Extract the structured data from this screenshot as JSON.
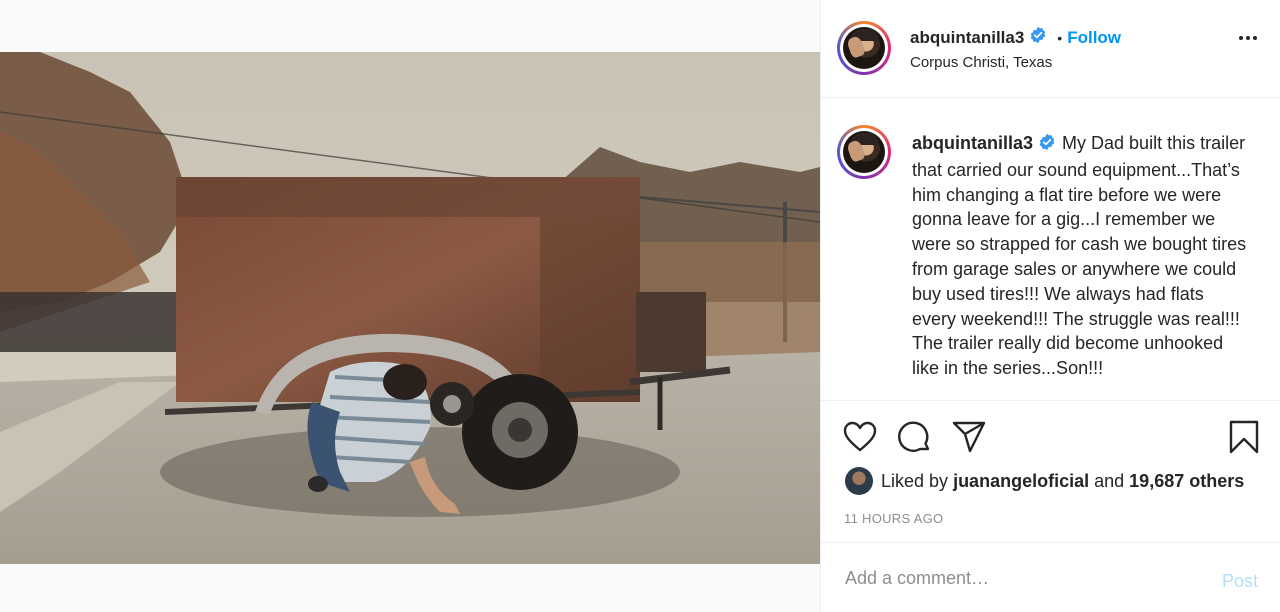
{
  "post": {
    "username": "abquintanilla3",
    "location": "Corpus Christi, Texas",
    "follow_label": "Follow",
    "separator": "•",
    "caption": "My Dad built this trailer that carried our sound equipment...That’s him changing a flat tire before we were gonna leave for a gig...I remember we were so strapped for cash we bought tires from garage sales or anywhere we could buy used tires!!! We always had flats every weekend!!! The struggle was real!!! The trailer really did become unhooked like in the series...Son!!!",
    "likes": {
      "prefix": "Liked by",
      "liker": "juanangeloficial",
      "middle": "and",
      "others": "19,687 others"
    },
    "timestamp": "11 HOURS AGO"
  },
  "comment": {
    "placeholder": "Add a comment…",
    "post_label": "Post"
  },
  "icons": {
    "verified": "verified-badge-icon",
    "more": "more-options-icon",
    "like": "heart-icon",
    "comment": "comment-bubble-icon",
    "share": "paper-plane-icon",
    "save": "bookmark-icon"
  },
  "colors": {
    "accent": "#0095f6",
    "post_disabled": "#b2dffc",
    "muted": "#8e8e8e"
  }
}
